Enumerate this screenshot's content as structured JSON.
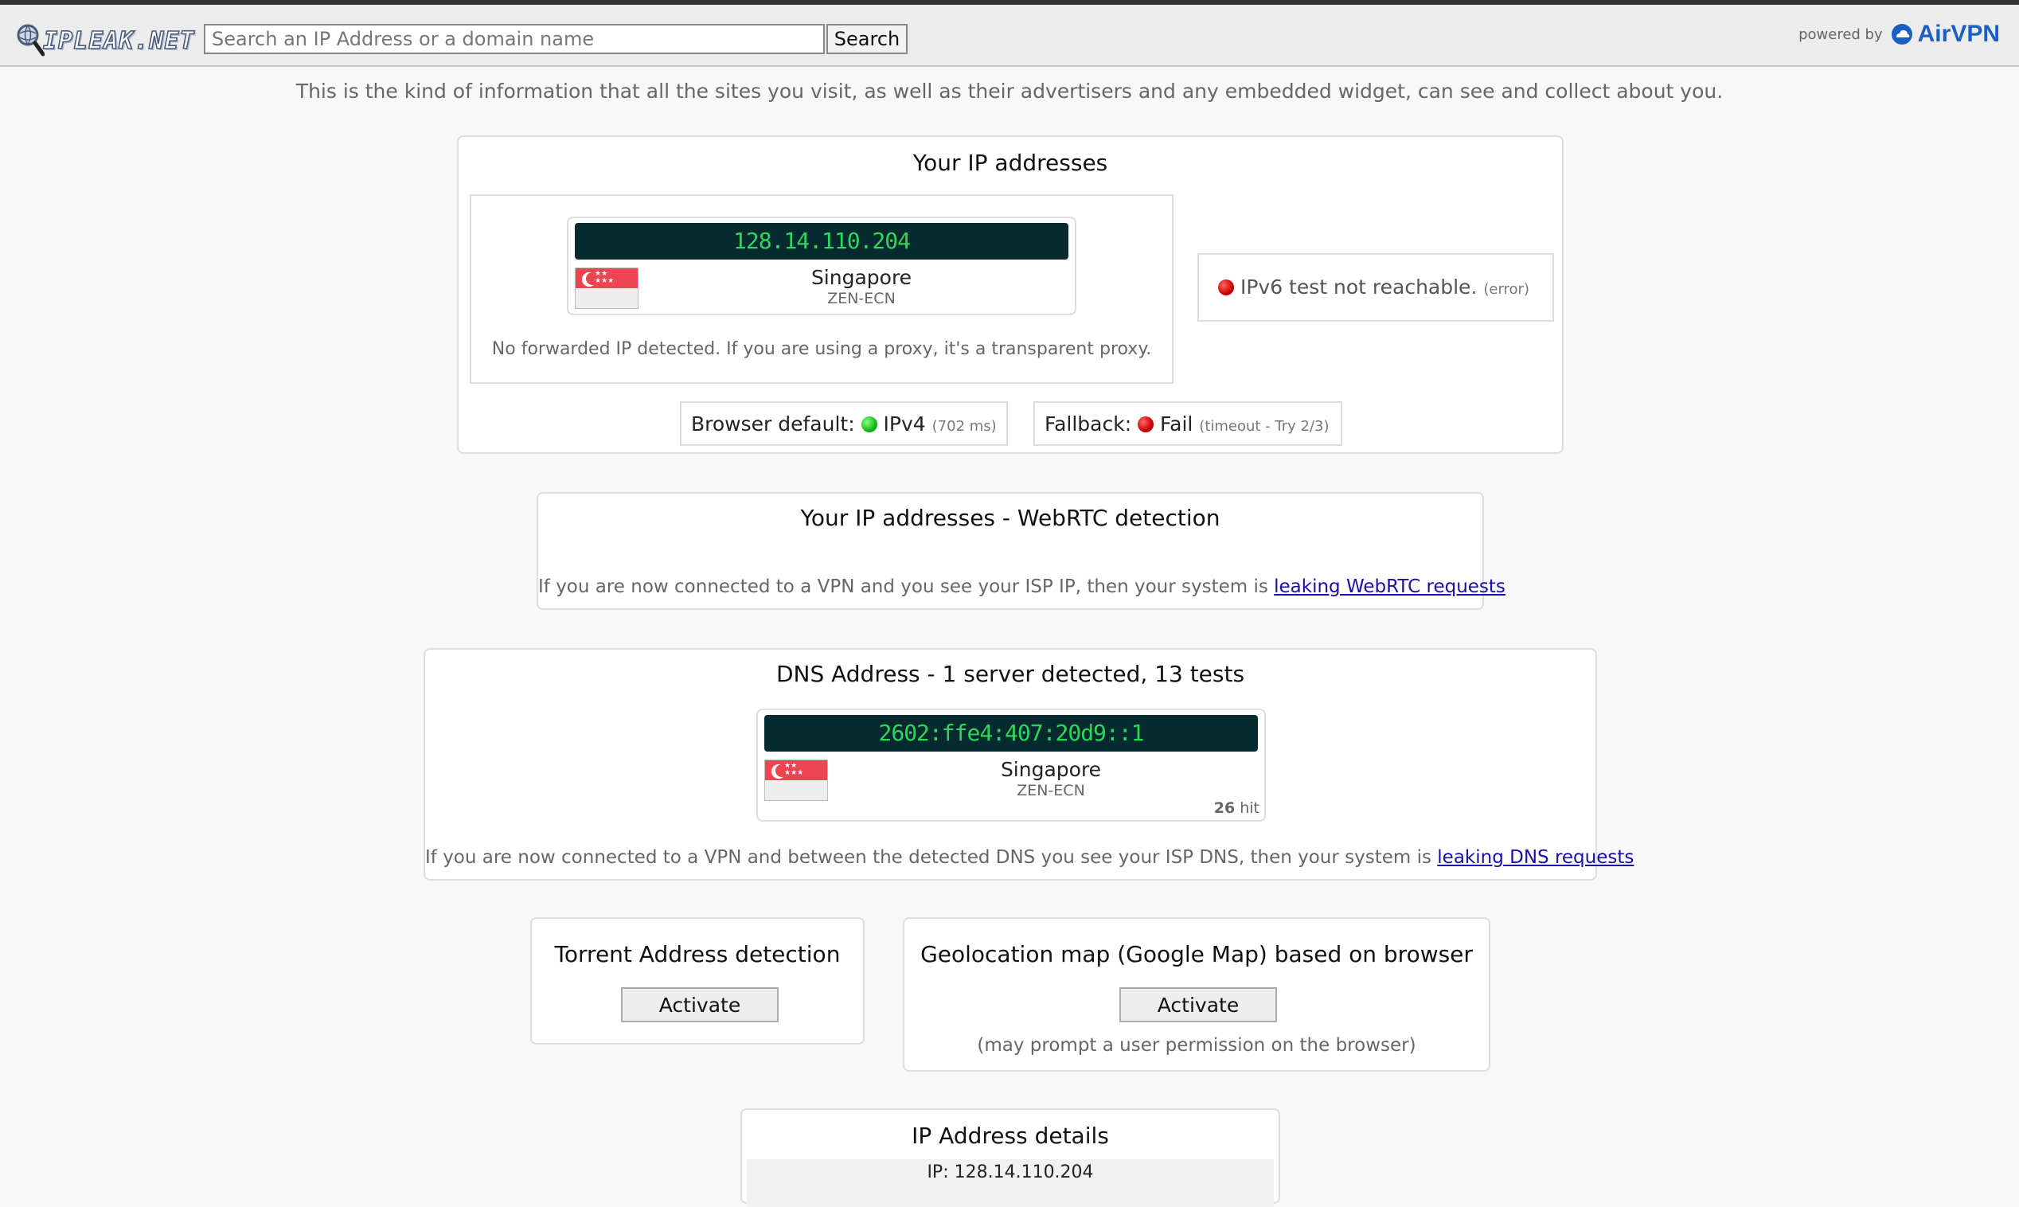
{
  "header": {
    "logo_text": "IPLEAK.NET",
    "search_placeholder": "Search an IP Address or a domain name",
    "search_button": "Search",
    "powered_label": "powered by",
    "powered_brand": "AirVPN"
  },
  "intro": "This is the kind of information that all the sites you visit, as well as their advertisers and any embedded widget, can see and collect about you.",
  "ip_section": {
    "title": "Your IP addresses",
    "ip": "128.14.110.204",
    "country": "Singapore",
    "isp": "ZEN-ECN",
    "forwarded_note": "No forwarded IP detected. If you are using a proxy, it's a transparent proxy.",
    "ipv6_text": "IPv6 test not reachable.",
    "ipv6_note": "(error)",
    "browser_default_label": "Browser default:",
    "browser_default_value": "IPv4",
    "browser_default_time": "(702 ms)",
    "fallback_label": "Fallback:",
    "fallback_value": "Fail",
    "fallback_note": "(timeout - Try 2/3)"
  },
  "webrtc_section": {
    "title": "Your IP addresses - WebRTC detection",
    "note": "If you are now connected to a VPN and you see your ISP IP, then your system is",
    "link": "leaking WebRTC requests"
  },
  "dns_section": {
    "title": "DNS Address - 1 server detected, 13 tests",
    "ip": "2602:ffe4:407:20d9::1",
    "country": "Singapore",
    "isp": "ZEN-ECN",
    "hits": "26",
    "hits_label": "hit",
    "note": "If you are now connected to a VPN and between the detected DNS you see your ISP DNS, then your system is",
    "link": "leaking DNS requests"
  },
  "torrent_section": {
    "title": "Torrent Address detection",
    "button": "Activate"
  },
  "geo_section": {
    "title": "Geolocation map (Google Map) based on browser",
    "button": "Activate",
    "note": "(may prompt a user permission on the browser)"
  },
  "details_section": {
    "title": "IP Address details",
    "first_row": "IP: 128.14.110.204"
  },
  "colors": {
    "ip_bar_bg": "#062a2f",
    "ip_bar_text": "#2cd85a",
    "link": "#1a0dab",
    "brand": "#1b5fc2"
  }
}
